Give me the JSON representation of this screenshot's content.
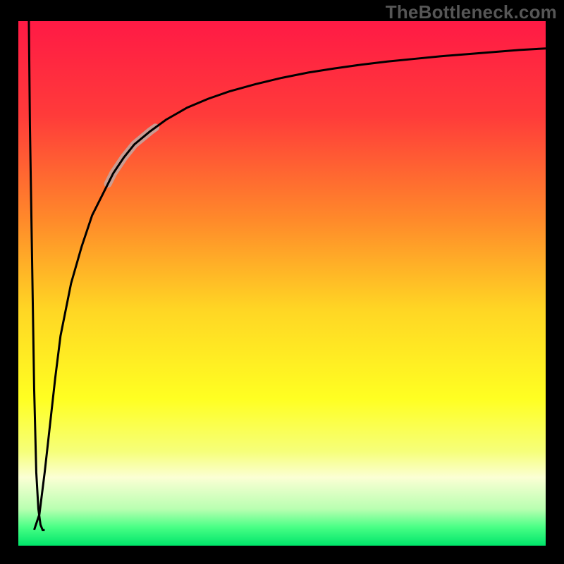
{
  "watermark": "TheBottleneck.com",
  "colors": {
    "frame": "#000000",
    "curve_stroke": "#000000",
    "highlight_stroke": "#c6a29b",
    "gradient_stops": [
      {
        "offset": 0.0,
        "color": "#ff1a45"
      },
      {
        "offset": 0.18,
        "color": "#ff3b3a"
      },
      {
        "offset": 0.38,
        "color": "#ff8a2a"
      },
      {
        "offset": 0.55,
        "color": "#ffd624"
      },
      {
        "offset": 0.72,
        "color": "#ffff22"
      },
      {
        "offset": 0.82,
        "color": "#f6ff79"
      },
      {
        "offset": 0.87,
        "color": "#fbffd4"
      },
      {
        "offset": 0.93,
        "color": "#b9ffb1"
      },
      {
        "offset": 0.965,
        "color": "#48ff85"
      },
      {
        "offset": 1.0,
        "color": "#00e56a"
      }
    ]
  },
  "chart_data": {
    "type": "line",
    "title": "",
    "xlabel": "",
    "ylabel": "",
    "xlim": [
      0,
      100
    ],
    "ylim": [
      0,
      100
    ],
    "legend": false,
    "grid": false,
    "notes": "Background is a vertical rainbow gradient from red (top) through orange/yellow to green (bottom). Two curve segments are drawn: a near-vertical drop at x≈2 from y≈100 to y≈3, then a steep rise-and-flatten curve from (≈3, 3) up toward (100, ≈95). A pale highlight marks the rising branch near x≈18–25.",
    "series": [
      {
        "name": "left-drop",
        "x": [
          2.0,
          2.2,
          2.6,
          3.0,
          3.4,
          3.8,
          4.2,
          4.6,
          5.0
        ],
        "values": [
          100,
          80,
          55,
          30,
          14,
          7,
          4,
          3,
          3
        ]
      },
      {
        "name": "rise-flatten",
        "x": [
          3,
          4,
          5,
          6,
          7,
          8,
          10,
          12,
          14,
          16,
          18,
          20,
          22,
          25,
          28,
          32,
          36,
          40,
          45,
          50,
          55,
          60,
          65,
          70,
          75,
          80,
          85,
          90,
          95,
          100
        ],
        "values": [
          3,
          6,
          14,
          23,
          32,
          40,
          50,
          57,
          63,
          67,
          71,
          74,
          76.5,
          79,
          81.2,
          83.5,
          85.2,
          86.6,
          88.0,
          89.2,
          90.2,
          91.0,
          91.7,
          92.3,
          92.8,
          93.3,
          93.7,
          94.1,
          94.5,
          94.8
        ]
      }
    ],
    "highlight_segment": {
      "series": "rise-flatten",
      "x_range": [
        17,
        26
      ]
    }
  }
}
